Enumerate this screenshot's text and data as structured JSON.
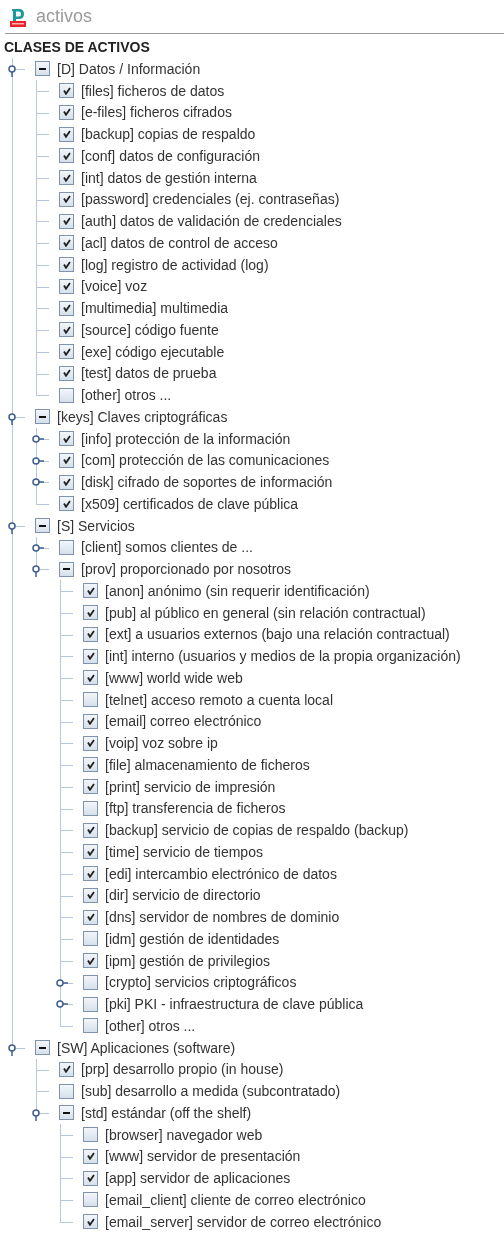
{
  "window": {
    "title": "activos"
  },
  "tree": {
    "label": "CLASES DE ACTIVOS",
    "children": [
      {
        "label": "[D] Datos / Información",
        "mixed": true,
        "expanded": true,
        "children": [
          {
            "label": "[files] ficheros de datos",
            "checked": true
          },
          {
            "label": "[e-files] ficheros cifrados",
            "checked": true
          },
          {
            "label": "[backup] copias de respaldo",
            "checked": true
          },
          {
            "label": "[conf] datos de configuración",
            "checked": true
          },
          {
            "label": "[int] datos de gestión interna",
            "checked": true
          },
          {
            "label": "[password] credenciales (ej. contraseñas)",
            "checked": true
          },
          {
            "label": "[auth] datos de validación de credenciales",
            "checked": true
          },
          {
            "label": "[acl] datos de control de acceso",
            "checked": true
          },
          {
            "label": "[log] registro de actividad (log)",
            "checked": true
          },
          {
            "label": "[voice] voz",
            "checked": true
          },
          {
            "label": "[multimedia] multimedia",
            "checked": true
          },
          {
            "label": "[source] código fuente",
            "checked": true
          },
          {
            "label": "[exe] código ejecutable",
            "checked": true
          },
          {
            "label": "[test] datos de prueba",
            "checked": true
          },
          {
            "label": "[other] otros ...",
            "checked": false
          }
        ]
      },
      {
        "label": "[keys] Claves criptográficas",
        "mixed": true,
        "expanded": true,
        "children": [
          {
            "label": "[info] protección de la información",
            "checked": true,
            "expanded": false
          },
          {
            "label": "[com] protección de las comunicaciones",
            "checked": true,
            "expanded": false
          },
          {
            "label": "[disk] cifrado de soportes de información",
            "checked": true,
            "expanded": false
          },
          {
            "label": "[x509] certificados de clave pública",
            "checked": true
          }
        ]
      },
      {
        "label": "[S] Servicios",
        "mixed": true,
        "expanded": true,
        "children": [
          {
            "label": "[client] somos clientes de ...",
            "checked": false,
            "expanded": false
          },
          {
            "label": "[prov] proporcionado por nosotros",
            "mixed": true,
            "expanded": true,
            "children": [
              {
                "label": "[anon] anónimo (sin requerir identificación)",
                "checked": true
              },
              {
                "label": "[pub] al público en general (sin relación contractual)",
                "checked": true
              },
              {
                "label": "[ext] a usuarios externos (bajo una relación contractual)",
                "checked": true
              },
              {
                "label": "[int] interno (usuarios y medios de la propia organización)",
                "checked": true
              },
              {
                "label": "[www] world wide web",
                "checked": true
              },
              {
                "label": "[telnet] acceso remoto a cuenta local",
                "checked": false
              },
              {
                "label": "[email] correo electrónico",
                "checked": true
              },
              {
                "label": "[voip] voz sobre ip",
                "checked": true
              },
              {
                "label": "[file] almacenamiento de ficheros",
                "checked": true
              },
              {
                "label": "[print] servicio de impresión",
                "checked": true
              },
              {
                "label": "[ftp] transferencia de ficheros",
                "checked": false
              },
              {
                "label": "[backup] servicio de copias de respaldo (backup)",
                "checked": true
              },
              {
                "label": "[time] servicio de tiempos",
                "checked": true
              },
              {
                "label": "[edi] intercambio electrónico de datos",
                "checked": true
              },
              {
                "label": "[dir] servicio de directorio",
                "checked": true
              },
              {
                "label": "[dns] servidor de nombres de dominio",
                "checked": true
              },
              {
                "label": "[idm] gestión de identidades",
                "checked": false
              },
              {
                "label": "[ipm] gestión de privilegios",
                "checked": true
              },
              {
                "label": "[crypto] servicios criptográficos",
                "checked": false,
                "expanded": false
              },
              {
                "label": "[pki] PKI - infraestructura de clave pública",
                "checked": false,
                "expanded": false
              },
              {
                "label": "[other] otros ...",
                "checked": false
              }
            ]
          }
        ]
      },
      {
        "label": "[SW] Aplicaciones (software)",
        "mixed": true,
        "expanded": true,
        "children": [
          {
            "label": "[prp] desarrollo propio (in house)",
            "checked": true
          },
          {
            "label": "[sub] desarrollo a medida (subcontratado)",
            "checked": false
          },
          {
            "label": "[std] estándar (off the shelf)",
            "mixed": true,
            "expanded": true,
            "children": [
              {
                "label": "[browser] navegador web",
                "checked": false
              },
              {
                "label": "[www] servidor de presentación",
                "checked": true
              },
              {
                "label": "[app] servidor de aplicaciones",
                "checked": true
              },
              {
                "label": "[email_client] cliente de correo electrónico",
                "checked": false
              },
              {
                "label": "[email_server] servidor de correo electrónico",
                "checked": true
              }
            ]
          }
        ]
      }
    ]
  }
}
